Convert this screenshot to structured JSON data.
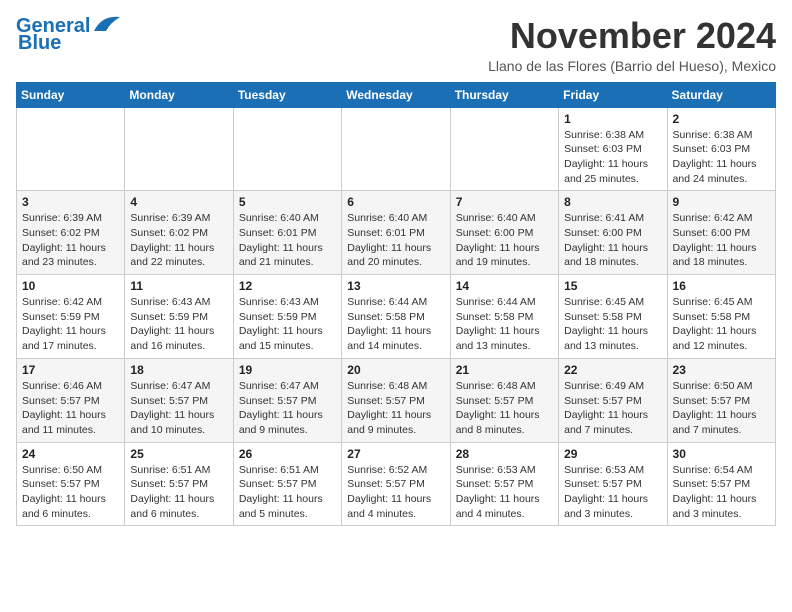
{
  "header": {
    "logo_line1": "General",
    "logo_line2": "Blue",
    "month": "November 2024",
    "location": "Llano de las Flores (Barrio del Hueso), Mexico"
  },
  "weekdays": [
    "Sunday",
    "Monday",
    "Tuesday",
    "Wednesday",
    "Thursday",
    "Friday",
    "Saturday"
  ],
  "weeks": [
    [
      {
        "day": "",
        "info": ""
      },
      {
        "day": "",
        "info": ""
      },
      {
        "day": "",
        "info": ""
      },
      {
        "day": "",
        "info": ""
      },
      {
        "day": "",
        "info": ""
      },
      {
        "day": "1",
        "info": "Sunrise: 6:38 AM\nSunset: 6:03 PM\nDaylight: 11 hours and 25 minutes."
      },
      {
        "day": "2",
        "info": "Sunrise: 6:38 AM\nSunset: 6:03 PM\nDaylight: 11 hours and 24 minutes."
      }
    ],
    [
      {
        "day": "3",
        "info": "Sunrise: 6:39 AM\nSunset: 6:02 PM\nDaylight: 11 hours and 23 minutes."
      },
      {
        "day": "4",
        "info": "Sunrise: 6:39 AM\nSunset: 6:02 PM\nDaylight: 11 hours and 22 minutes."
      },
      {
        "day": "5",
        "info": "Sunrise: 6:40 AM\nSunset: 6:01 PM\nDaylight: 11 hours and 21 minutes."
      },
      {
        "day": "6",
        "info": "Sunrise: 6:40 AM\nSunset: 6:01 PM\nDaylight: 11 hours and 20 minutes."
      },
      {
        "day": "7",
        "info": "Sunrise: 6:40 AM\nSunset: 6:00 PM\nDaylight: 11 hours and 19 minutes."
      },
      {
        "day": "8",
        "info": "Sunrise: 6:41 AM\nSunset: 6:00 PM\nDaylight: 11 hours and 18 minutes."
      },
      {
        "day": "9",
        "info": "Sunrise: 6:42 AM\nSunset: 6:00 PM\nDaylight: 11 hours and 18 minutes."
      }
    ],
    [
      {
        "day": "10",
        "info": "Sunrise: 6:42 AM\nSunset: 5:59 PM\nDaylight: 11 hours and 17 minutes."
      },
      {
        "day": "11",
        "info": "Sunrise: 6:43 AM\nSunset: 5:59 PM\nDaylight: 11 hours and 16 minutes."
      },
      {
        "day": "12",
        "info": "Sunrise: 6:43 AM\nSunset: 5:59 PM\nDaylight: 11 hours and 15 minutes."
      },
      {
        "day": "13",
        "info": "Sunrise: 6:44 AM\nSunset: 5:58 PM\nDaylight: 11 hours and 14 minutes."
      },
      {
        "day": "14",
        "info": "Sunrise: 6:44 AM\nSunset: 5:58 PM\nDaylight: 11 hours and 13 minutes."
      },
      {
        "day": "15",
        "info": "Sunrise: 6:45 AM\nSunset: 5:58 PM\nDaylight: 11 hours and 13 minutes."
      },
      {
        "day": "16",
        "info": "Sunrise: 6:45 AM\nSunset: 5:58 PM\nDaylight: 11 hours and 12 minutes."
      }
    ],
    [
      {
        "day": "17",
        "info": "Sunrise: 6:46 AM\nSunset: 5:57 PM\nDaylight: 11 hours and 11 minutes."
      },
      {
        "day": "18",
        "info": "Sunrise: 6:47 AM\nSunset: 5:57 PM\nDaylight: 11 hours and 10 minutes."
      },
      {
        "day": "19",
        "info": "Sunrise: 6:47 AM\nSunset: 5:57 PM\nDaylight: 11 hours and 9 minutes."
      },
      {
        "day": "20",
        "info": "Sunrise: 6:48 AM\nSunset: 5:57 PM\nDaylight: 11 hours and 9 minutes."
      },
      {
        "day": "21",
        "info": "Sunrise: 6:48 AM\nSunset: 5:57 PM\nDaylight: 11 hours and 8 minutes."
      },
      {
        "day": "22",
        "info": "Sunrise: 6:49 AM\nSunset: 5:57 PM\nDaylight: 11 hours and 7 minutes."
      },
      {
        "day": "23",
        "info": "Sunrise: 6:50 AM\nSunset: 5:57 PM\nDaylight: 11 hours and 7 minutes."
      }
    ],
    [
      {
        "day": "24",
        "info": "Sunrise: 6:50 AM\nSunset: 5:57 PM\nDaylight: 11 hours and 6 minutes."
      },
      {
        "day": "25",
        "info": "Sunrise: 6:51 AM\nSunset: 5:57 PM\nDaylight: 11 hours and 6 minutes."
      },
      {
        "day": "26",
        "info": "Sunrise: 6:51 AM\nSunset: 5:57 PM\nDaylight: 11 hours and 5 minutes."
      },
      {
        "day": "27",
        "info": "Sunrise: 6:52 AM\nSunset: 5:57 PM\nDaylight: 11 hours and 4 minutes."
      },
      {
        "day": "28",
        "info": "Sunrise: 6:53 AM\nSunset: 5:57 PM\nDaylight: 11 hours and 4 minutes."
      },
      {
        "day": "29",
        "info": "Sunrise: 6:53 AM\nSunset: 5:57 PM\nDaylight: 11 hours and 3 minutes."
      },
      {
        "day": "30",
        "info": "Sunrise: 6:54 AM\nSunset: 5:57 PM\nDaylight: 11 hours and 3 minutes."
      }
    ]
  ]
}
